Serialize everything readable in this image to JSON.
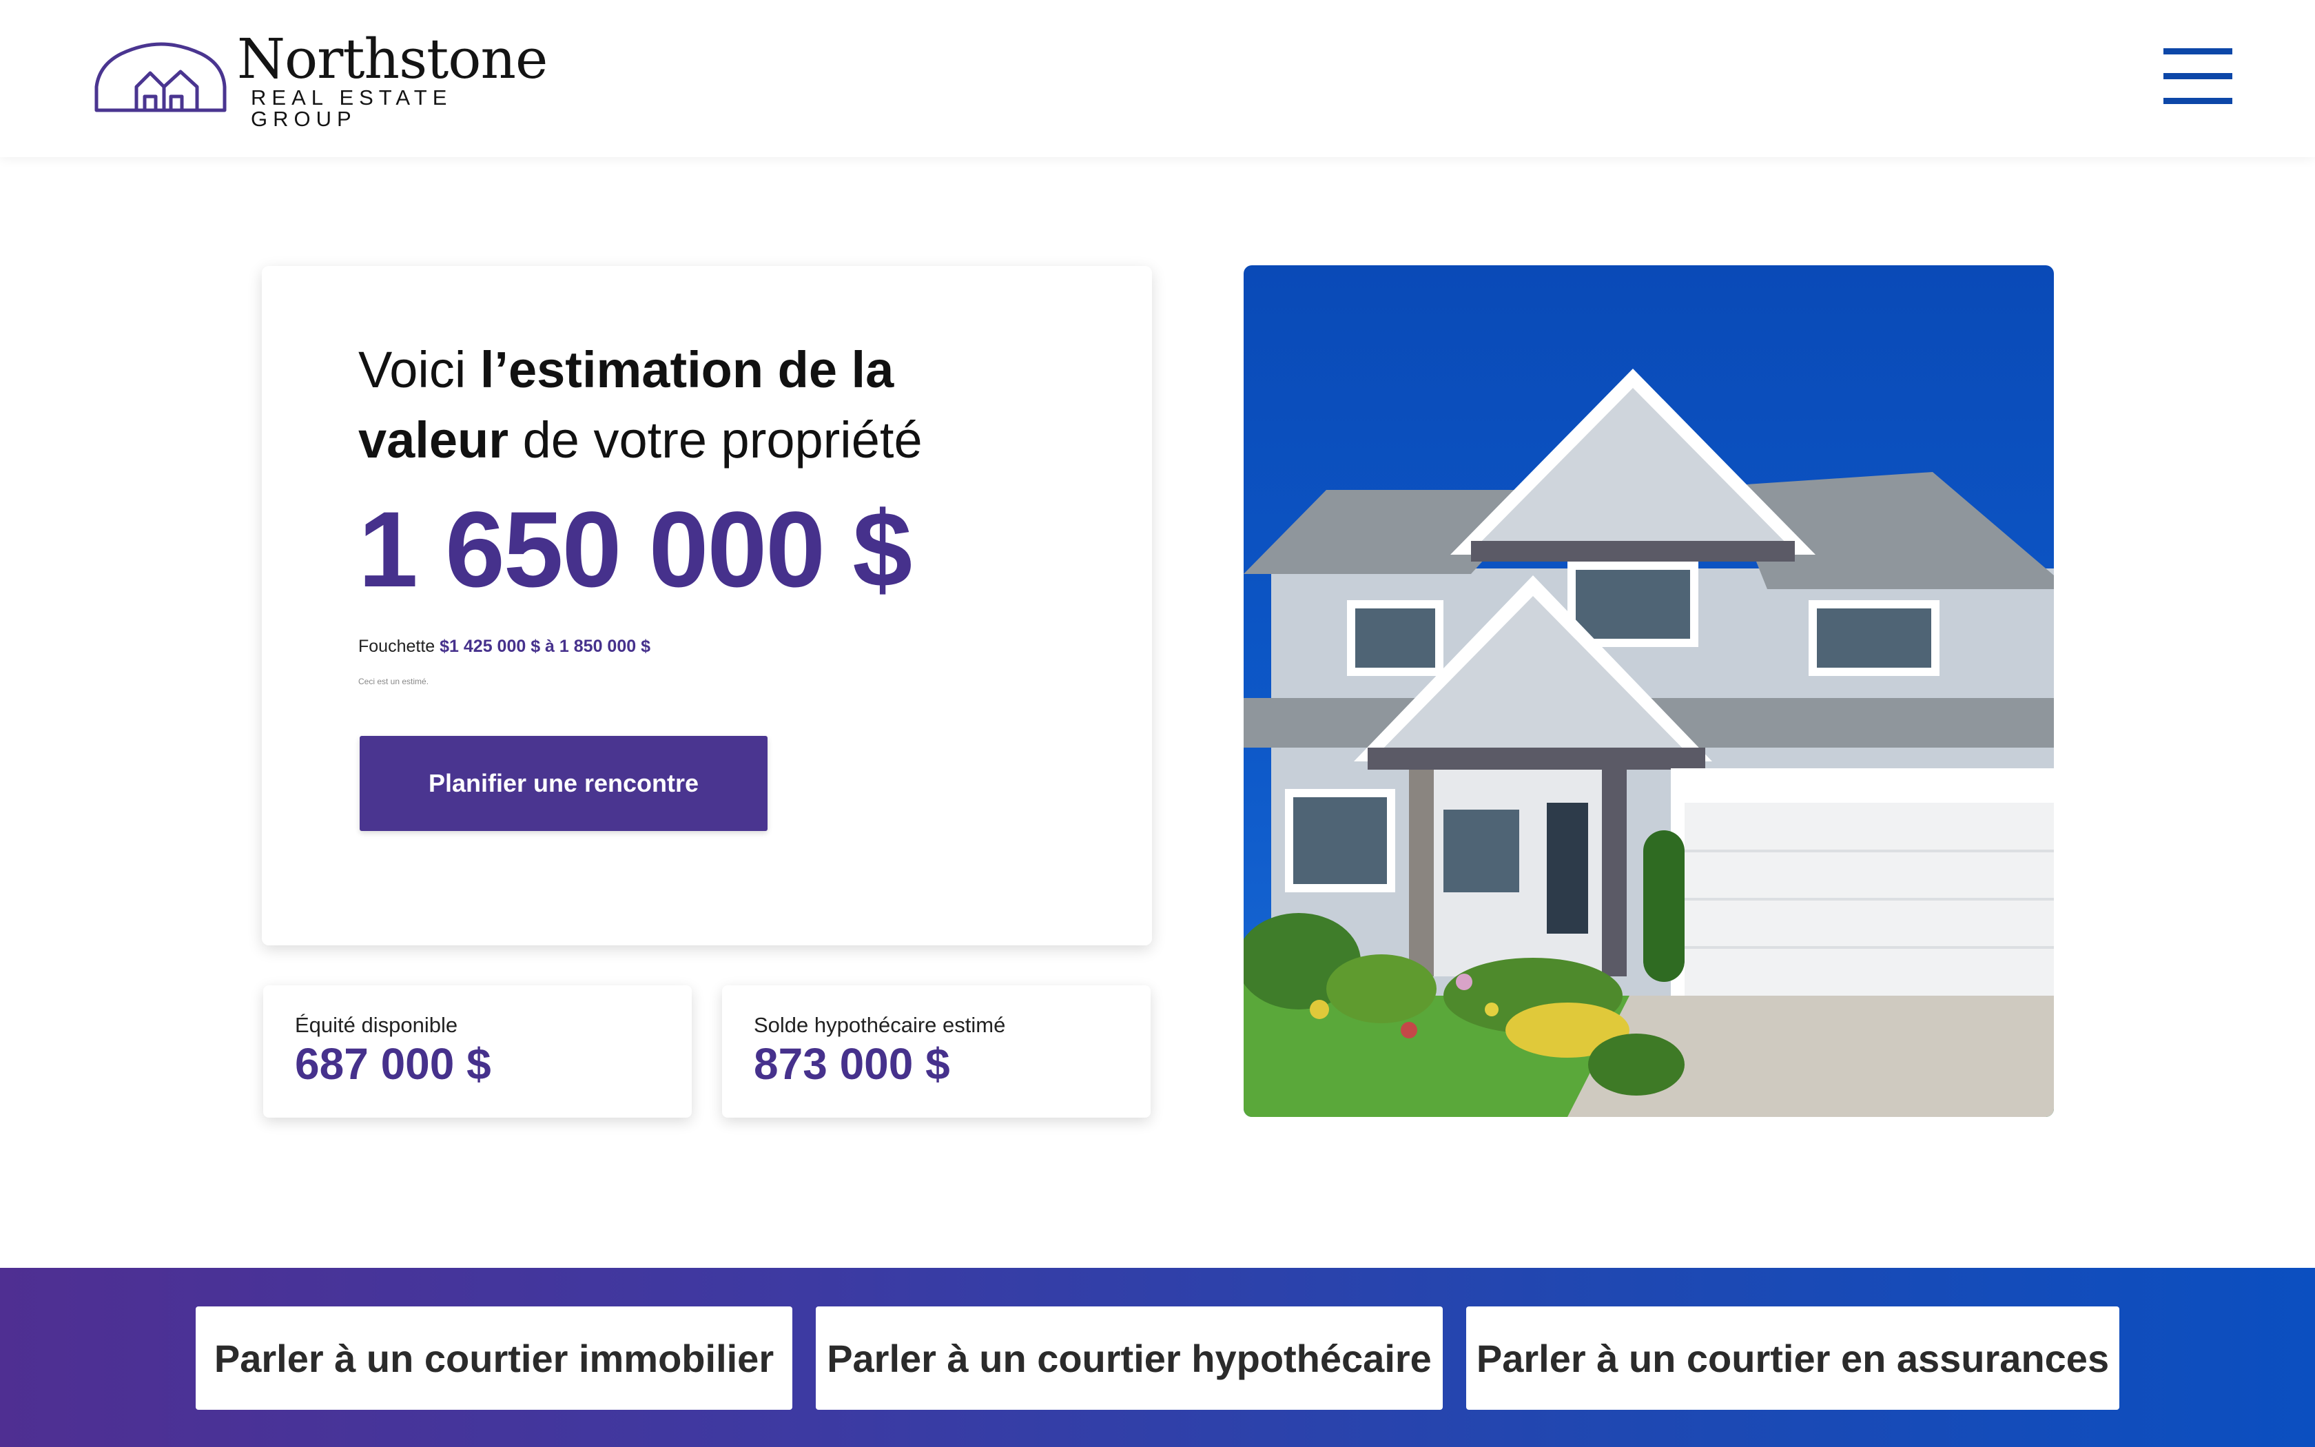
{
  "header": {
    "brand_name": "Northstone",
    "brand_tagline": "REAL ESTATE GROUP",
    "logo_icon": "house-outline-icon",
    "menu_icon": "hamburger-menu-icon"
  },
  "estimate": {
    "heading_part1": "Voici ",
    "heading_bold1": "l’estimation de la",
    "heading_bold2": "valeur",
    "heading_part2": " de votre propriété",
    "value": "1 650 000 $",
    "range_label": "Fouchette ",
    "range_value": "$1 425 000 $ à 1 850 000 $",
    "note": "Ceci est un estimé.",
    "cta_label": "Planifier une rencontre"
  },
  "stats": {
    "equity_label": "Équité disponible",
    "equity_value": "687 000 $",
    "mortgage_label": "Solde hypothécaire estimé",
    "mortgage_value": "873 000 $"
  },
  "brokers": {
    "real_estate": "Parler à un courtier immobilier",
    "mortgage": "Parler à un courtier hypothécaire",
    "insurance": "Parler à un courtier en assurances"
  },
  "colors": {
    "accent": "#46318c",
    "button": "#4a3590",
    "menu": "#0d47a8",
    "band_start": "#4f2f92",
    "band_end": "#0b4fc0"
  }
}
